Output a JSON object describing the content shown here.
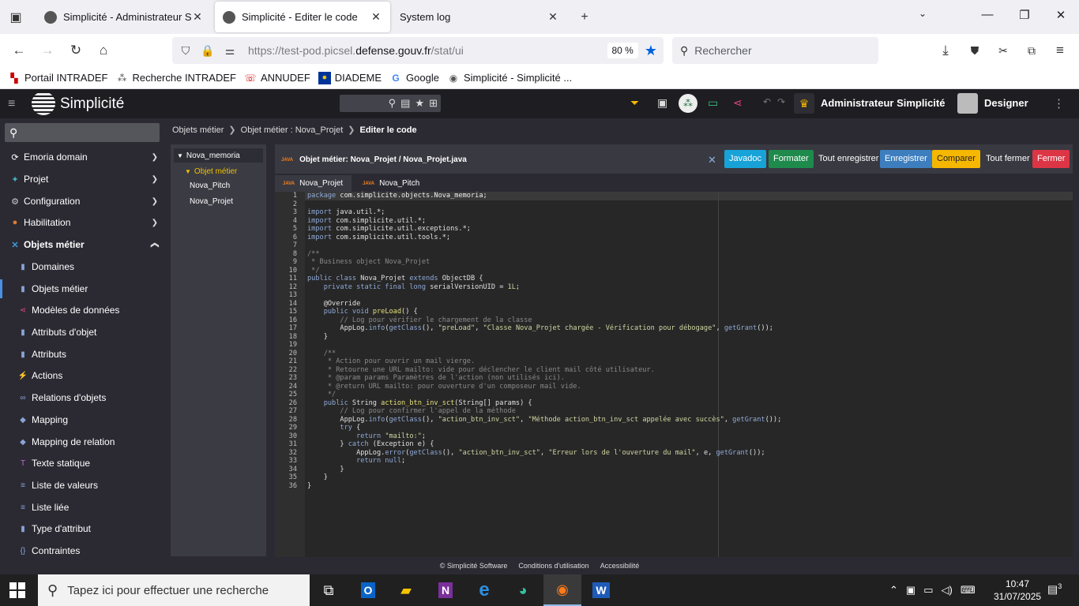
{
  "browser": {
    "tabs": [
      {
        "title": "Simplicité - Administrateur Simplicité",
        "active": false
      },
      {
        "title": "Simplicité - Editer le code",
        "active": true
      },
      {
        "title": "System log",
        "active": false
      }
    ],
    "url_prefix": "https://test-pod.picsel.",
    "url_domain": "defense.gouv.fr",
    "url_suffix": "/stat/ui",
    "zoom": "80 %",
    "search_placeholder": "Rechercher",
    "bookmarks": [
      {
        "label": "Portail INTRADEF",
        "icon": "flag-icon"
      },
      {
        "label": "Recherche INTRADEF",
        "icon": "network-icon"
      },
      {
        "label": "ANNUDEF",
        "icon": "phone-icon"
      },
      {
        "label": "DIADEME",
        "icon": "eu-flag-icon"
      },
      {
        "label": "Google",
        "icon": "google-icon"
      },
      {
        "label": "Simplicité - Simplicité ...",
        "icon": "simplicite-icon"
      }
    ]
  },
  "app": {
    "name": "Simplicité",
    "scope": "Administrateur Simplicité",
    "user": "Designer",
    "accent": "#4a90e2"
  },
  "sidebar": {
    "groups": [
      {
        "label": "Emoria domain",
        "icon": "⟳",
        "color": "#fff"
      },
      {
        "label": "Projet",
        "icon": "✦",
        "color": "#4ab0c0"
      },
      {
        "label": "Configuration",
        "icon": "⚙",
        "color": "#ccc"
      },
      {
        "label": "Habilitation",
        "icon": "●",
        "color": "#e07a30"
      },
      {
        "label": "Objets métier",
        "icon": "✕",
        "color": "#3a9ad9"
      }
    ],
    "items": [
      {
        "label": "Domaines",
        "icon": "▮"
      },
      {
        "label": "Objets métier",
        "icon": "▮"
      },
      {
        "label": "Modèles de données",
        "icon": "⋖"
      },
      {
        "label": "Attributs d'objet",
        "icon": "▮"
      },
      {
        "label": "Attributs",
        "icon": "▮"
      },
      {
        "label": "Actions",
        "icon": "⚡"
      },
      {
        "label": "Relations d'objets",
        "icon": "∞"
      },
      {
        "label": "Mapping",
        "icon": "◆"
      },
      {
        "label": "Mapping de relation",
        "icon": "◆"
      },
      {
        "label": "Texte statique",
        "icon": "T"
      },
      {
        "label": "Liste de valeurs",
        "icon": "≡"
      },
      {
        "label": "Liste liée",
        "icon": "≡"
      },
      {
        "label": "Type d'attribut",
        "icon": "▮"
      },
      {
        "label": "Contraintes",
        "icon": "{}"
      }
    ]
  },
  "breadcrumb": [
    "Objets métier",
    "Objet métier : Nova_Projet",
    "Editer le code"
  ],
  "tree": {
    "root": "Nova_memoria",
    "folder": "Objet métier",
    "files": [
      "Nova_Pitch",
      "Nova_Projet"
    ]
  },
  "editor": {
    "java_badge": "JAVA",
    "title": "Objet métier: Nova_Projet / Nova_Projet.java",
    "buttons": {
      "javadoc": "Javadoc",
      "format": "Formater",
      "save_all": "Tout enregistrer",
      "save": "Enregistrer",
      "compare": "Comparer",
      "close_all": "Tout fermer",
      "close": "Fermer"
    },
    "button_colors": {
      "javadoc": "#17a2d8",
      "format": "#1e8a4c",
      "save": "#3d7ebf",
      "compare": "#f5b700",
      "close": "#dc3545"
    },
    "tabs": [
      "Nova_Projet",
      "Nova_Pitch"
    ],
    "line_numbers": [
      "1",
      "2",
      "3",
      "4",
      "5",
      "6",
      "7",
      "8",
      "9",
      "10",
      "11",
      "12",
      "13",
      "14",
      "15",
      "16",
      "17",
      "18",
      "19",
      "20",
      "21",
      "22",
      "23",
      "24",
      "25",
      "26",
      "27",
      "28",
      "29",
      "30",
      "31",
      "32",
      "33",
      "34",
      "35",
      "36"
    ]
  },
  "footer": [
    "© Simplicité Software",
    "Conditions d'utilisation",
    "Accessibilité"
  ],
  "taskbar": {
    "search_placeholder": "Tapez ici pour effectuer une recherche",
    "time": "10:47",
    "date": "31/07/2025",
    "notifications": "3"
  }
}
